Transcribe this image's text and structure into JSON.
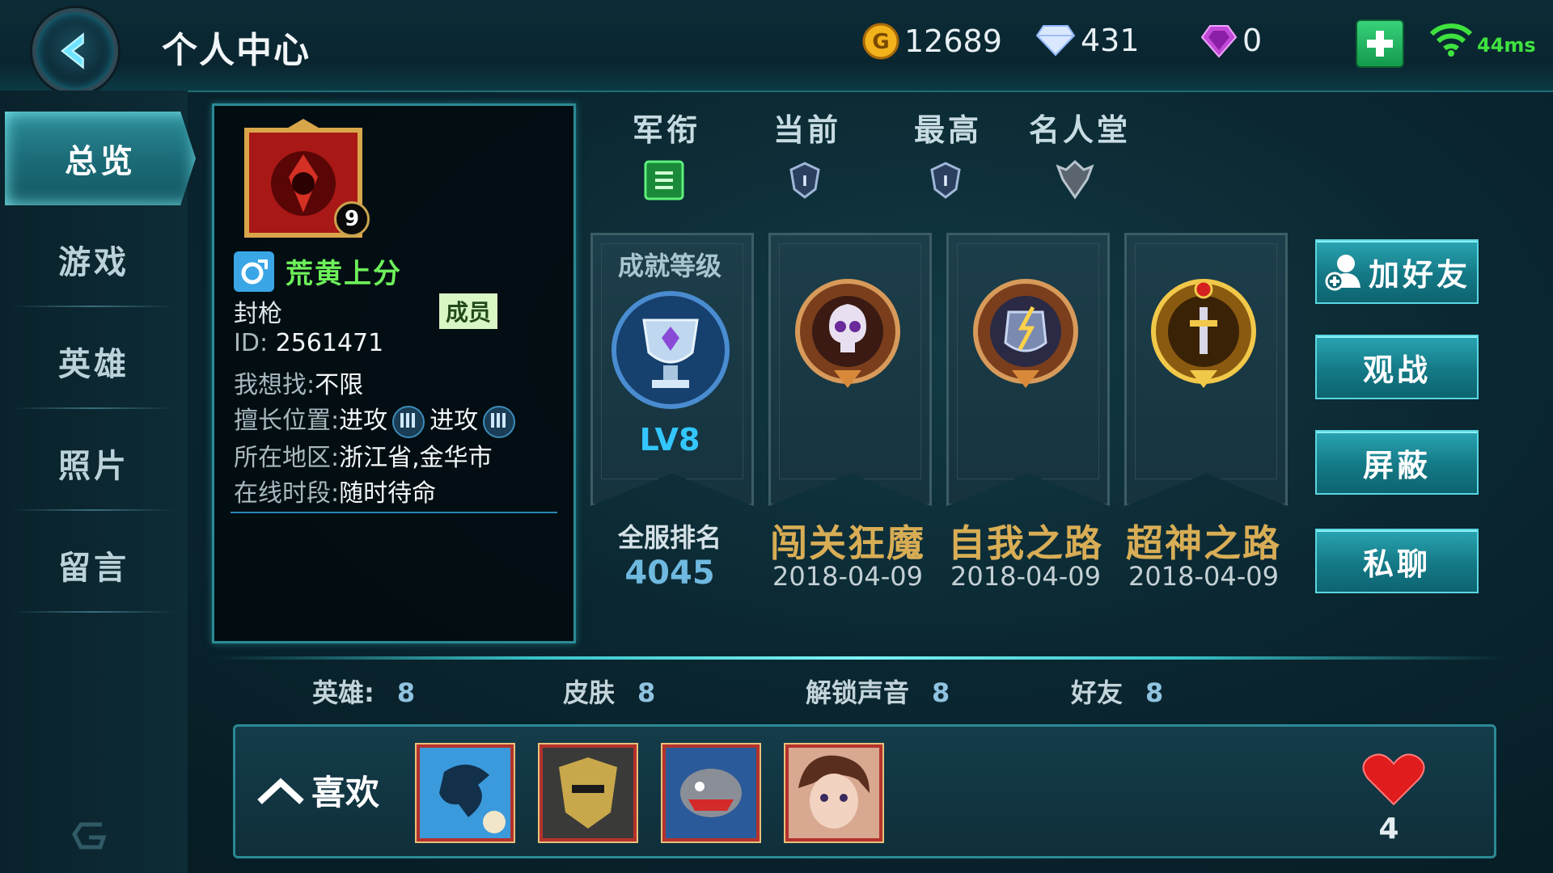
{
  "header": {
    "title": "个人中心",
    "gold": "12689",
    "diamonds": "431",
    "gems": "0",
    "ping": "44ms"
  },
  "sidebar": {
    "items": [
      {
        "label": "总览",
        "active": true
      },
      {
        "label": "游戏",
        "active": false
      },
      {
        "label": "英雄",
        "active": false
      },
      {
        "label": "照片",
        "active": false
      },
      {
        "label": "留言",
        "active": false
      }
    ]
  },
  "profile": {
    "level": "9",
    "name": "荒黄上分",
    "title": "封枪",
    "member_badge": "成员",
    "id_label": "ID:",
    "id": "2561471",
    "seek_label": "我想找:",
    "seek": "不限",
    "position_label": "擅长位置:",
    "position1": "进攻",
    "position2": "进攻",
    "region_label": "所在地区:",
    "region": "浙江省,金华市",
    "online_label": "在线时段:",
    "online": "随时待命"
  },
  "rank": {
    "headers": [
      "军衔",
      "当前",
      "最高",
      "名人堂"
    ]
  },
  "achievement": {
    "level_label": "成就等级",
    "level": "LV8",
    "server_rank_label": "全服排名",
    "server_rank": "4045",
    "items": [
      {
        "name": "闯关狂魔",
        "date": "2018-04-09"
      },
      {
        "name": "自我之路",
        "date": "2018-04-09"
      },
      {
        "name": "超神之路",
        "date": "2018-04-09"
      }
    ]
  },
  "actions": [
    "加好友",
    "观战",
    "屏蔽",
    "私聊"
  ],
  "counts": [
    {
      "label": "英雄:",
      "value": "8"
    },
    {
      "label": "皮肤",
      "value": "8"
    },
    {
      "label": "解锁声音",
      "value": "8"
    },
    {
      "label": "好友",
      "value": "8"
    }
  ],
  "favorites": {
    "label": "喜欢",
    "likes": "4"
  },
  "colors": {
    "accent": "#2aa4b2",
    "name_green": "#6ef05a",
    "gold_text": "#d8ad55",
    "level_blue": "#33c6ff"
  }
}
